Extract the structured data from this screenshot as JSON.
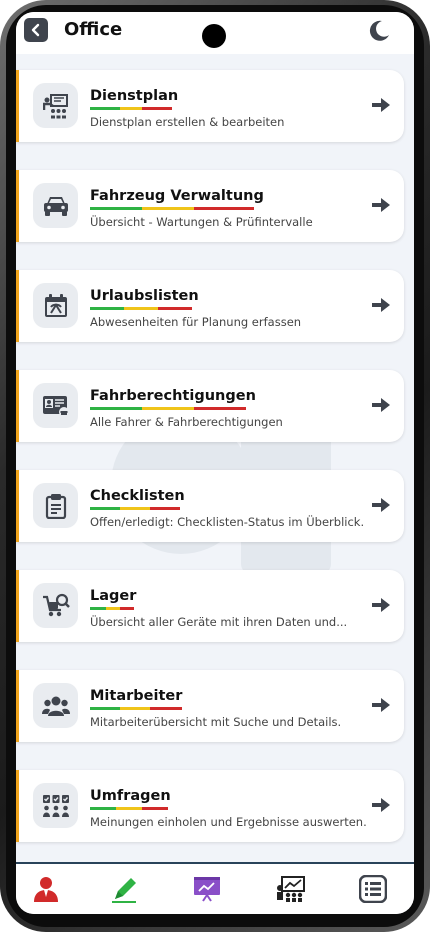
{
  "header": {
    "title": "Office"
  },
  "items": [
    {
      "title": "Dienstplan",
      "subtitle": "Dienstplan erstellen & bearbeiten",
      "icon": "schedule-presentation-icon"
    },
    {
      "title": "Fahrzeug Verwaltung",
      "subtitle": "Übersicht - Wartungen & Prüfintervalle",
      "icon": "car-icon"
    },
    {
      "title": "Urlaubslisten",
      "subtitle": "Abwesenheiten für Planung erfassen",
      "icon": "calendar-vacation-icon"
    },
    {
      "title": "Fahrberechtigungen",
      "subtitle": "Alle Fahrer & Fahrberechtigungen",
      "icon": "license-card-icon"
    },
    {
      "title": "Checklisten",
      "subtitle": "Offen/erledigt: Checklisten-Status im Überblick.",
      "icon": "clipboard-icon"
    },
    {
      "title": "Lager",
      "subtitle": "Übersicht aller Geräte mit ihren Daten und...",
      "icon": "cart-search-icon"
    },
    {
      "title": "Mitarbeiter",
      "subtitle": "Mitarbeiterübersicht mit Suche und Details.",
      "icon": "users-icon"
    },
    {
      "title": "Umfragen",
      "subtitle": "Meinungen einholen und Ergebnisse auswerten.",
      "icon": "survey-icon"
    }
  ],
  "bottom_nav": [
    {
      "icon": "user-icon",
      "color": "#d12a2a"
    },
    {
      "icon": "pencil-icon",
      "color": "#2fb344"
    },
    {
      "icon": "presentation-icon",
      "color": "#8a4fc8"
    },
    {
      "icon": "chart-team-icon",
      "color": "#222222"
    },
    {
      "icon": "list-icon",
      "color": "#3f444d"
    }
  ],
  "colors": {
    "accent_border": "#f1a51d",
    "underline": [
      "#2fb344",
      "#f0c419",
      "#d12a2a"
    ],
    "nav_border": "#29435a"
  }
}
